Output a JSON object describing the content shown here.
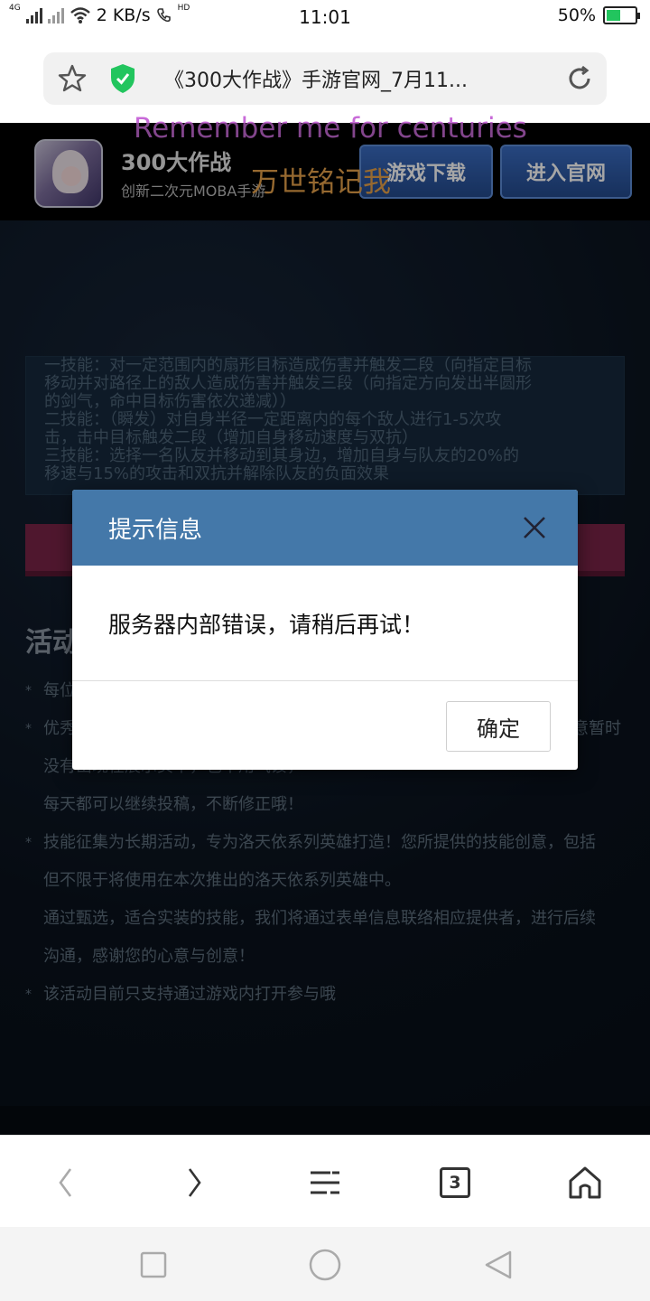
{
  "status_bar": {
    "net_speed": "2 KB/s",
    "time": "11:01",
    "battery": "50%",
    "battery_level": 0.5,
    "network_label": "4G",
    "hd_label": "HD"
  },
  "url_bar": {
    "title": "《300大作战》手游官网_7月11..."
  },
  "banner": {
    "app_name": "300大作战",
    "app_subtitle": "创新二次元MOBA手游",
    "download_button": "游戏下载",
    "official_button": "进入官网",
    "overlay_english": "Remember me for centuries",
    "overlay_chinese": "万世铭记我"
  },
  "page": {
    "skills_text": [
      "一技能：对一定范围内的扇形目标造成伤害并触发二段（向指定目标",
      "移动并对路径上的敌人造成伤害并触发三段（向指定方向发出半圆形",
      "的剑气，命中目标伤害依次递减））",
      "二技能：（瞬发）对自身半径一定距离内的每个敌人进行1-5次攻",
      "击，击中目标触发二段（增加自身移动速度与双抗）",
      "三技能：选择一名队友并移动到其身边，增加自身与队友的20%的",
      "移速与15%的攻击和双抗并解除队友的负面效果"
    ],
    "activity_heading": "活动",
    "activity_items": [
      {
        "star": "*",
        "text": "每位"
      },
      {
        "star": "*",
        "text": "优秀"
      },
      {
        "star": "",
        "text": "没有出现在展示页中，也不用气馁，"
      },
      {
        "star": "",
        "text": "每天都可以继续投稿，不断修正哦！"
      },
      {
        "star": "*",
        "text": "技能征集为长期活动，专为洛天依系列英雄打造！您所提供的技能创意，包括"
      },
      {
        "star": "",
        "text": "但不限于将使用在本次推出的洛天依系列英雄中。"
      },
      {
        "star": "",
        "text": "通过甄选，适合实装的技能，我们将通过表单信息联络相应提供者，进行后续"
      },
      {
        "star": "",
        "text": "沟通，感谢您的心意与创意！"
      },
      {
        "star": "*",
        "text": "该活动目前只支持通过游戏内打开参与哦"
      }
    ],
    "partial_right_text": "意暂时"
  },
  "dialog": {
    "title": "提示信息",
    "message": "服务器内部错误，请稍后再试！",
    "ok_button": "确定"
  },
  "browser_nav": {
    "tab_count": "3"
  },
  "icons": {
    "star": "star-icon",
    "shield": "shield-check-icon",
    "refresh": "refresh-icon",
    "close": "close-icon",
    "back": "chevron-left-icon",
    "forward": "chevron-right-icon",
    "menu": "menu-icon",
    "tabs": "tabs-icon",
    "home": "home-icon"
  },
  "colors": {
    "dialog_header": "#4478a9",
    "shield_green": "#22c55e",
    "overlay_english": "#c86ad8",
    "overlay_chinese": "#e6a24a"
  }
}
